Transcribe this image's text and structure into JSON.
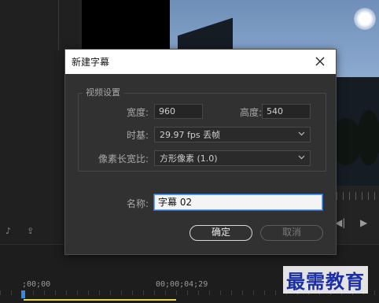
{
  "dialog": {
    "title": "新建字幕",
    "video_settings_label": "视频设置",
    "width_label": "宽度:",
    "width_value": "960",
    "height_label": "高度:",
    "height_value": "540",
    "timebase_label": "时基:",
    "timebase_value": "29.97 fps 丢帧",
    "pixel_aspect_label": "像素长宽比:",
    "pixel_aspect_value": "方形像素 (1.0)",
    "name_label": "名称:",
    "name_value": "字幕 02",
    "ok_label": "确定",
    "cancel_label": "取消"
  },
  "timeline": {
    "timecode_start": ";00;00",
    "timecode_mid": "00;00;04;29"
  },
  "watermark": {
    "text": "最需教育"
  },
  "colors": {
    "dialog_bg": "#313131",
    "titlebar_bg": "#ffffff",
    "accent": "#2d8ceb",
    "work_area": "#e8d44d",
    "watermark": "#1d2fa7"
  }
}
